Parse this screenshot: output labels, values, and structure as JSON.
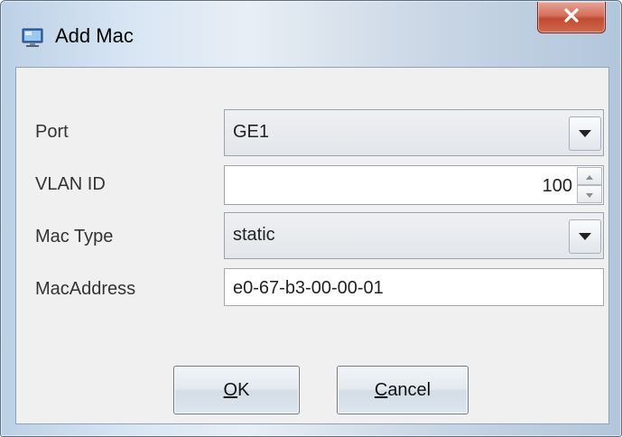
{
  "window": {
    "title": "Add Mac",
    "icons": {
      "app": "app-window-icon",
      "close": "close-icon"
    }
  },
  "form": {
    "port": {
      "label": "Port",
      "value": "GE1"
    },
    "vlan_id": {
      "label": "VLAN ID",
      "value": "100"
    },
    "mac_type": {
      "label": "Mac Type",
      "value": "static"
    },
    "mac_address": {
      "label": "MacAddress",
      "value": "e0-67-b3-00-00-01"
    }
  },
  "buttons": {
    "ok": {
      "mnemonic": "O",
      "rest": "K"
    },
    "cancel": {
      "mnemonic": "C",
      "rest": "ancel"
    }
  },
  "colors": {
    "close_button": "#c14a32",
    "content_bg": "#f0f0f0"
  }
}
